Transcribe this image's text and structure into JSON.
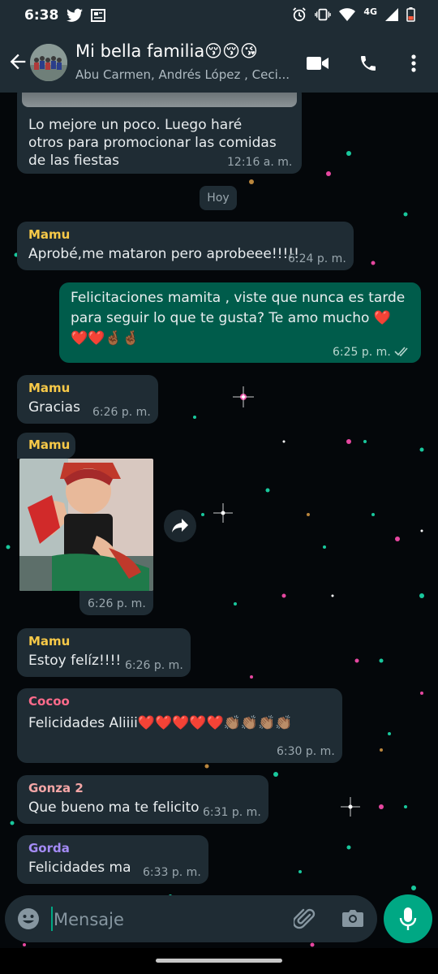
{
  "status_bar": {
    "time": "6:38",
    "network": "4G"
  },
  "header": {
    "title": "Mi bella familia😚😚😘",
    "subtitle": "Abu Carmen, Andrés López , Ceci...",
    "icons": [
      "back-arrow-icon",
      "video-call-icon",
      "voice-call-icon",
      "more-options-icon"
    ]
  },
  "messages": [
    {
      "type": "in",
      "sender": "",
      "text": "Lo mejore un poco. Luego haré otros para promocionar las comidas de las fiestas",
      "time": "12:16 a. m."
    },
    {
      "type": "day",
      "text": "Hoy"
    },
    {
      "type": "in",
      "sender": "Mamu",
      "sender_color": "#f7c948",
      "text": "Aprobé,me mataron pero aprobeee!!!!!",
      "time": "6:24 p. m."
    },
    {
      "type": "out",
      "text": "Felicitaciones mamita , viste que nunca es tarde para seguir lo que te gusta? Te amo mucho ❤️❤️❤️🤞🏾🤞🏾",
      "time": "6:25 p. m.",
      "status": "read"
    },
    {
      "type": "in",
      "sender": "Mamu",
      "sender_color": "#f7c948",
      "text": "Gracias",
      "time": "6:26 p. m."
    },
    {
      "type": "in-image",
      "sender": "Mamu",
      "sender_color": "#f7c948",
      "time": "6:26 p. m."
    },
    {
      "type": "in",
      "sender": "Mamu",
      "sender_color": "#f7c948",
      "text": "Estoy felíz!!!!",
      "time": "6:26 p. m."
    },
    {
      "type": "in",
      "sender": "Cocoo",
      "sender_color": "#ff6b8b",
      "text": "Felicidades Aliiii❤️❤️❤️❤️❤️👏🏽👏🏽👏🏽👏🏽",
      "time": "6:30 p. m."
    },
    {
      "type": "in",
      "sender": "Gonza 2",
      "sender_color": "#f5a6a6",
      "text": "Que bueno ma te felicito",
      "time": "6:31 p. m."
    },
    {
      "type": "in",
      "sender": "Gorda",
      "sender_color": "#a48bf5",
      "text": "Felicidades ma",
      "time": "6:33 p. m."
    }
  ],
  "composer": {
    "placeholder": "Mensaje"
  },
  "colors": {
    "bar": "#1f2c34",
    "incoming": "#1f2c34",
    "outgoing": "#005c4b",
    "accent": "#00a884"
  }
}
